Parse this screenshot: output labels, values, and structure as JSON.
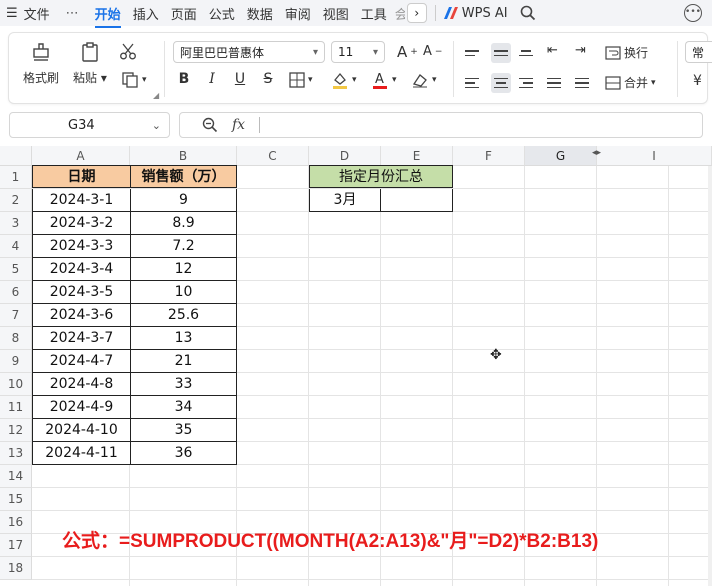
{
  "menu": {
    "hamburger": "☰",
    "file": "文件",
    "more": "⋯",
    "tabs": [
      "开始",
      "插入",
      "页面",
      "公式",
      "数据",
      "审阅",
      "视图",
      "工具",
      "会"
    ],
    "active_tab": "开始",
    "arrow": "›",
    "wps_ai": "WPS AI"
  },
  "ribbon": {
    "format_painter": "格式刷",
    "paste": "粘贴",
    "font_name": "阿里巴巴普惠体",
    "font_size": "11",
    "bold": "B",
    "italic": "I",
    "underline": "U",
    "strike": "S",
    "wrap_text": "换行",
    "merge": "合并",
    "number_format": "常",
    "currency": "¥"
  },
  "formula_bar": {
    "name_box": "G34",
    "fx": "fx",
    "content": ""
  },
  "grid": {
    "columns": [
      "A",
      "B",
      "C",
      "D",
      "E",
      "F",
      "G",
      "I"
    ],
    "selected_column": "G",
    "rows": [
      "1",
      "2",
      "3",
      "4",
      "5",
      "6",
      "7",
      "8",
      "9",
      "10",
      "11",
      "12",
      "13",
      "14",
      "15",
      "16",
      "17",
      "18"
    ],
    "table": {
      "headers": [
        "日期",
        "销售额（万）"
      ],
      "rows": [
        [
          "2024-3-1",
          "9"
        ],
        [
          "2024-3-2",
          "8.9"
        ],
        [
          "2024-3-3",
          "7.2"
        ],
        [
          "2024-3-4",
          "12"
        ],
        [
          "2024-3-5",
          "10"
        ],
        [
          "2024-3-6",
          "25.6"
        ],
        [
          "2024-3-7",
          "13"
        ],
        [
          "2024-4-7",
          "21"
        ],
        [
          "2024-4-8",
          "33"
        ],
        [
          "2024-4-9",
          "34"
        ],
        [
          "2024-4-10",
          "35"
        ],
        [
          "2024-4-11",
          "36"
        ]
      ]
    },
    "summary": {
      "title": "指定月份汇总",
      "month": "3月",
      "result": ""
    },
    "formula_note": "公式：=SUMPRODUCT((MONTH(A2:A13)&\"月\"=D2)*B2:B13)"
  },
  "colors": {
    "accent": "#1a73e8",
    "header_fill": "#f8cba1",
    "summary_fill": "#c5dea8",
    "note_red": "#e81c1c"
  }
}
